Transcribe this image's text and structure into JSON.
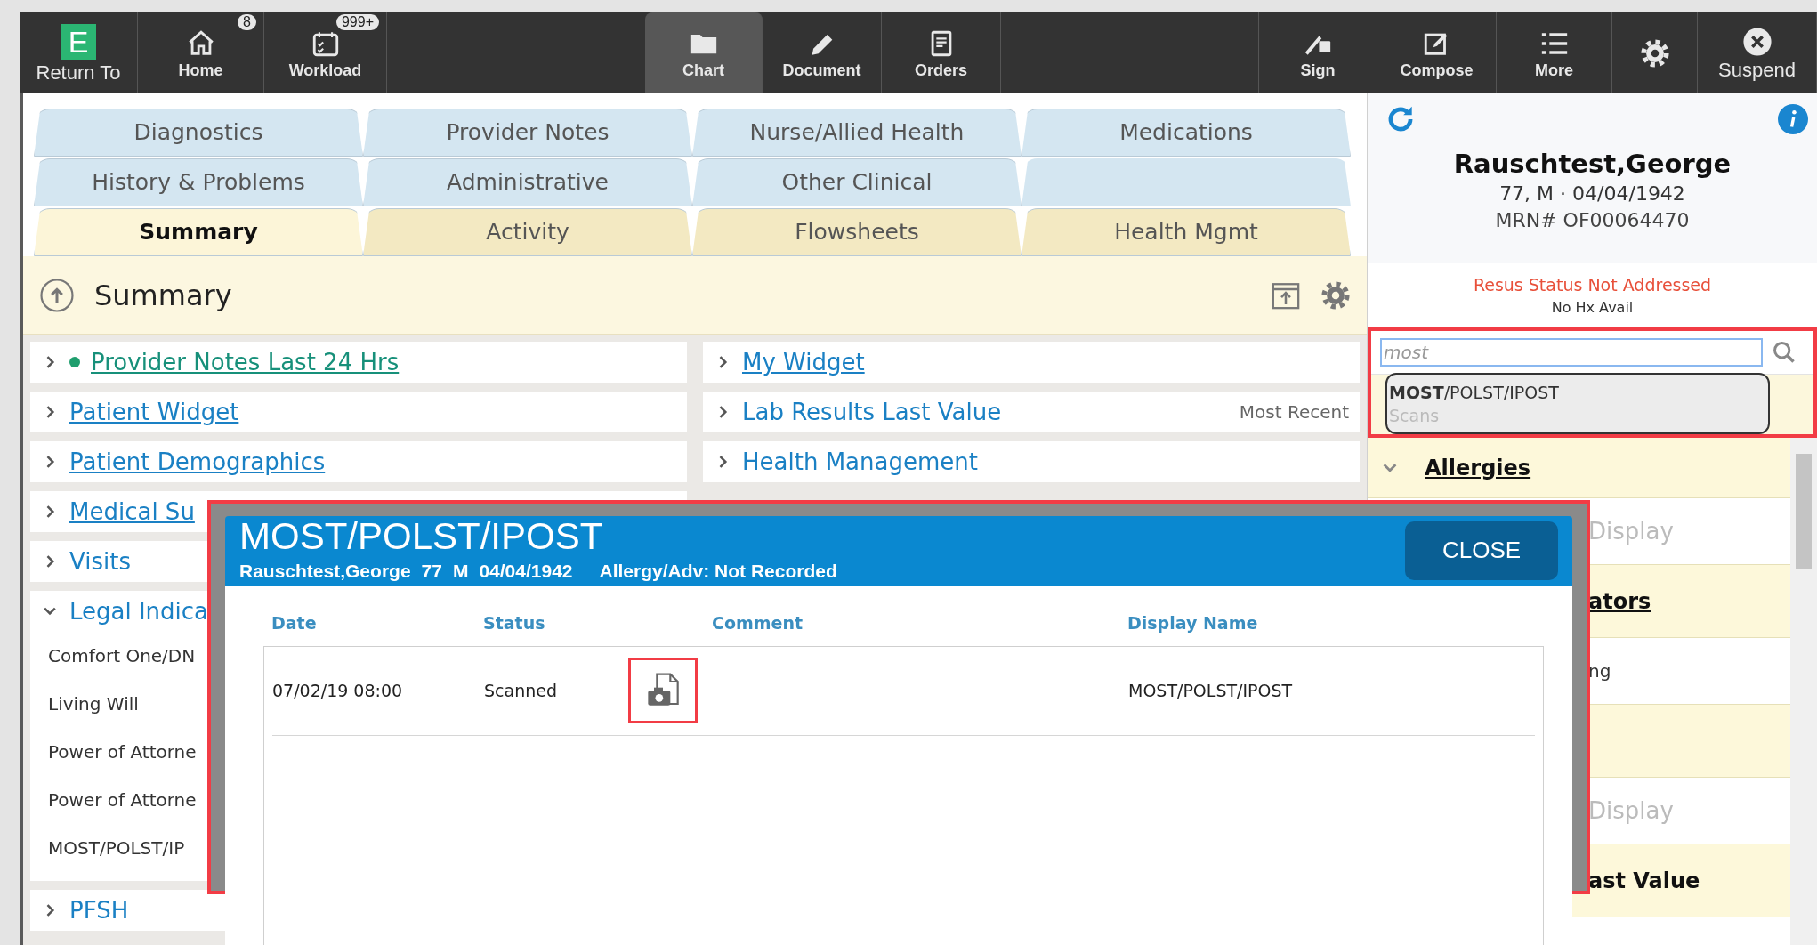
{
  "toolbar": {
    "groups": [
      [
        {
          "logo": "E",
          "label": "Return To",
          "selected": false
        },
        {
          "label": "Home",
          "badge": "8",
          "selected": false
        },
        {
          "label": "Workload",
          "badge": "999+",
          "selected": false
        }
      ],
      [
        {
          "label": "Chart",
          "selected": true
        },
        {
          "label": "Document",
          "selected": false
        },
        {
          "label": "Orders",
          "selected": false
        }
      ],
      [
        {
          "label": "Sign",
          "selected": false
        },
        {
          "label": "Compose",
          "selected": false
        },
        {
          "label": "More",
          "selected": false
        },
        {
          "selected": false
        },
        {
          "label": "Suspend",
          "selected": false
        }
      ]
    ]
  },
  "tabs": {
    "rows": [
      [
        {
          "label": "Diagnostics",
          "selected": false
        },
        {
          "label": "Provider Notes",
          "selected": false
        },
        {
          "label": "Nurse/Allied Health",
          "selected": false
        },
        {
          "label": "Medications",
          "selected": false
        }
      ],
      [
        {
          "label": "History & Problems",
          "selected": false
        },
        {
          "label": "Administrative",
          "selected": false
        },
        {
          "label": "Other Clinical",
          "selected": false
        }
      ],
      [
        {
          "label": "Summary",
          "selected": true
        },
        {
          "label": "Activity",
          "selected": false
        },
        {
          "label": "Flowsheets",
          "selected": false
        },
        {
          "label": "Health Mgmt",
          "selected": false
        }
      ]
    ]
  },
  "summary": {
    "title": "Summary"
  },
  "widgets": {
    "columns": [
      [
        {
          "label": "Provider Notes Last 24 Hrs",
          "underlined": true,
          "expanded": false,
          "color": "#1f9e6e"
        },
        {
          "label": "Patient Widget",
          "underlined": true,
          "expanded": false
        },
        {
          "label": "Patient Demographics",
          "underlined": true,
          "expanded": false
        },
        {
          "label": "Medical Su",
          "underlined": true,
          "expanded": false
        },
        {
          "label": "Visits",
          "underlined": false,
          "expanded": false
        },
        {
          "label": "Legal Indica",
          "underlined": false,
          "expanded": true,
          "items": [
            "Comfort One/DN",
            "Living Will",
            "Power of Attorne",
            "Power of Attorne",
            "MOST/POLST/IP"
          ]
        },
        {
          "label": "PFSH",
          "underlined": false,
          "expanded": false
        }
      ],
      [
        {
          "label": "My Widget",
          "underlined": true,
          "expanded": false
        },
        {
          "label": "Lab Results Last Value",
          "underlined": false,
          "expanded": false,
          "note": "Most Recent"
        },
        {
          "label": "Health Management",
          "underlined": false,
          "expanded": false
        }
      ]
    ]
  },
  "patient": {
    "name": "Rauschtest,George",
    "demographics": "77, M · 04/04/1942",
    "mrn": "MRN# OF00064470",
    "resus": "Resus Status Not Addressed",
    "history": "No Hx Avail"
  },
  "search": {
    "value": "most",
    "suggestion": {
      "title": "**MOST**/POLST/IPOST",
      "category": "Scans"
    }
  },
  "side_sections": [
    {
      "kind": "header",
      "label": "Allergies",
      "underlined": true,
      "expanded": true
    },
    {
      "kind": "empty",
      "label": "Display"
    },
    {
      "kind": "header",
      "label": "ators",
      "underlined": true
    },
    {
      "kind": "item",
      "label": "ng"
    },
    {
      "kind": "header"
    },
    {
      "kind": "empty",
      "label": "Display"
    },
    {
      "kind": "header",
      "label": "ast Value",
      "underlined": false
    }
  ],
  "modal": {
    "title": "MOST/POLST/IPOST",
    "subtitle": [
      "Rauschtest,George",
      "77",
      "M",
      "04/04/1942",
      "Allergy/Adv: Not Recorded"
    ],
    "close": "CLOSE",
    "columns": [
      "Date",
      "Status",
      "Comment",
      "Display Name"
    ],
    "rows": [
      {
        "date": "07/02/19 08:00",
        "status": "Scanned",
        "attachment": true,
        "display_name": "MOST/POLST/IPOST"
      }
    ]
  }
}
